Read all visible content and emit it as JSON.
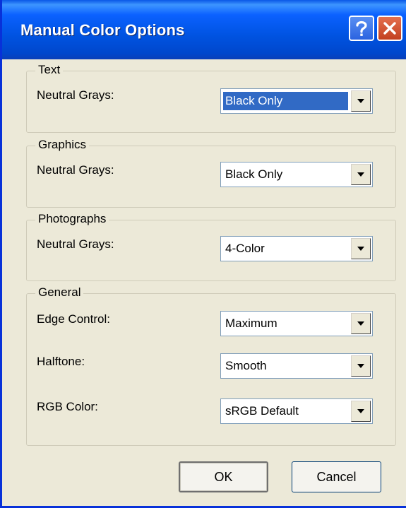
{
  "dialog": {
    "title": "Manual Color Options",
    "colors": {
      "titlebar": "#0053e1",
      "selection": "#316ac5",
      "face": "#ece9d8"
    }
  },
  "text_group": {
    "legend": "Text",
    "neutral_grays_label": "Neutral Grays:",
    "neutral_grays_value": "Black Only"
  },
  "graphics_group": {
    "legend": "Graphics",
    "neutral_grays_label": "Neutral Grays:",
    "neutral_grays_value": "Black Only"
  },
  "photographs_group": {
    "legend": "Photographs",
    "neutral_grays_label": "Neutral Grays:",
    "neutral_grays_value": "4-Color"
  },
  "general_group": {
    "legend": "General",
    "edge_control_label": "Edge Control:",
    "edge_control_value": "Maximum",
    "halftone_label": "Halftone:",
    "halftone_value": "Smooth",
    "rgb_color_label": "RGB Color:",
    "rgb_color_value": "sRGB Default"
  },
  "buttons": {
    "ok": "OK",
    "cancel": "Cancel"
  },
  "icons": {
    "help": "help-icon",
    "close": "close-icon",
    "dropdown": "chevron-down-icon"
  }
}
